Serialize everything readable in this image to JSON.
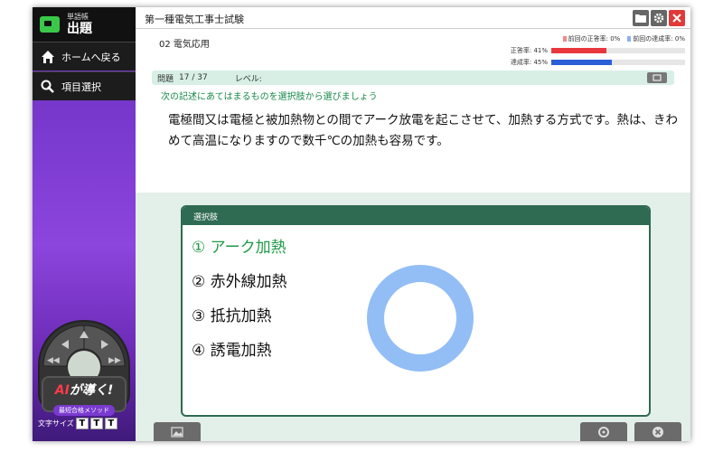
{
  "sidebar": {
    "logo_sub": "単語帳",
    "logo_title": "出題",
    "home_label": "ホームへ戻る",
    "select_label": "項目選択",
    "ai_badge_main_1": "AI",
    "ai_badge_main_2": "が導く!",
    "ai_badge_sub": "最短合格メソッド",
    "font_size_label": "文字サイズ",
    "font_size_buttons": [
      "T",
      "T",
      "T"
    ]
  },
  "header": {
    "title": "第一種電気工事士試験"
  },
  "subject": "02 電気応用",
  "stats": {
    "legend_prev_correct": "前回の正答率:",
    "legend_prev_correct_value": "0%",
    "legend_prev_achieve": "前回の達成率:",
    "legend_prev_achieve_value": "0%",
    "correct_label": "正答率:",
    "correct_value": "41%",
    "correct_fraction": 0.41,
    "achieve_label": "達成率:",
    "achieve_value": "45%",
    "achieve_fraction": 0.45,
    "colors": {
      "correct": "#e8383d",
      "achieve": "#2a5fd8",
      "prev_correct": "#f08a8a",
      "prev_achieve": "#8ab0f0"
    }
  },
  "question_bar": {
    "label": "問題",
    "number": "17 / 37",
    "level_label": "レベル:"
  },
  "instruction": "次の記述にあてはまるものを選択肢から選びましょう",
  "question_text": "電極間又は電極と被加熱物との間でアーク放電を起こさせて、加熱する方式です。熱は、きわめて高温になりますので数千℃の加熱も容易です。",
  "choices": {
    "header": "選択肢",
    "items": [
      {
        "label": "① アーク加熱"
      },
      {
        "label": "② 赤外線加熱"
      },
      {
        "label": "③ 抵抗加熱"
      },
      {
        "label": "④ 誘電加熱"
      }
    ]
  }
}
